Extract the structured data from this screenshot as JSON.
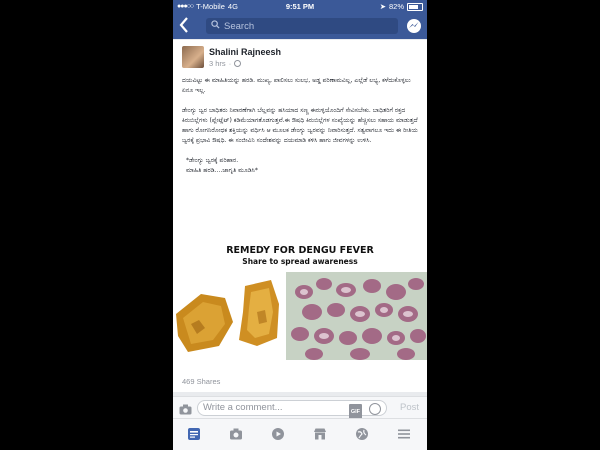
{
  "status": {
    "carrier": "T-Mobile",
    "network": "4G",
    "time": "9:51 PM",
    "battery": "82%"
  },
  "nav": {
    "search_placeholder": "Search"
  },
  "post": {
    "author": "Shalini Rajneesh",
    "time": "3 hrs",
    "paragraphs": [
      "ದಯವಿಟ್ಟು ಈ ಮಾಹಿತಿಯನ್ನು ಹರಡಿ. ಮುಖ್ಯ, ಪಾಲಿಸಲು ಸುಲಭ, ಅಡ್ಡ ಪರಿಣಾಮವಿಲ್ಲ, ಎಲ್ಲೆಡೆ ಲಭ್ಯ, ಕಳೆದುಕೊಳ್ಳಲು ಏನೂ ಇಲ್ಲ.",
      "ಡೇಂಗ್ಯು ಜ್ವರ ಬಾಧಿತರು ನಿವಾರಣೆಗಾಗಿ ಬೆಲ್ಲವನ್ನು ಹಸಿಯಾದ ಸಣ್ಣ ಈರುಳ್ಳಿಯೊಂದಿಗೆ ಸೇವಿಸಬೇಕು. ಬಾಧಿತರಿಗೆ ರಕ್ತದ ಕಿರುಬಿಲ್ಲೆಗಳು (ಪ್ಲೇಟ್ಲೆಟ್) ಕಡಿಮೆಯಾಗತೊಡಗುತ್ತವೆ.ಈ ಔಷಧಿ ಕಿರುಬಿಲ್ಲೆಗಳ ಸಂಖ್ಯೆಯನ್ನು ಹೆಚ್ಚಿಸಲು ಸಹಾಯ ಮಾಡುತ್ತದೆ ಹಾಗು ರೋಗನಿರೋಧಕ ಶಕ್ತಿಯನ್ನು ವರ್ಧಿಸಿ ಆ ಮೂಲಕ ಡೇಂಗ್ಯು ಜ್ವರವನ್ನು ನಿವಾರಿಸುತ್ತದೆ. ಸತ್ವವಾಗಲೂ ಇದು ಈ ರೀತಿಯ ಜ್ವರಕ್ಕೆ ಪ್ರಭಾವಿ ಔಷಧಿ. ಈ ಸಂಜೀವಿನಿ ಸಂದೇಶವನ್ನು ದಯಮಾಡಿ ಕಳಿಸಿ ಹಾಗು ಜೀವಗಳನ್ನು ಉಳಿಸಿ."
    ],
    "closing_line1": "*ಡೇಂಗ್ಯು ಜ್ವರಕ್ಕೆ ಪರಿಹಾರ.",
    "closing_line2": "ಮಾಹಿತಿ ಹರಡಿ....ಜಾಗೃತಿ ಮೂಡಿಸಿ*",
    "banner_title": "REMEDY FOR DENGU FEVER",
    "banner_subtitle": "Share to spread awareness",
    "shares": "469 Shares"
  },
  "comment": {
    "placeholder": "Write a comment...",
    "gif_label": "GIF",
    "post_label": "Post"
  },
  "icons": {
    "back": "chevron-left-icon",
    "messenger": "messenger-icon",
    "camera": "camera-icon",
    "tabs": [
      "news-feed-icon",
      "camera-icon",
      "video-icon",
      "marketplace-icon",
      "globe-icon",
      "menu-icon"
    ]
  },
  "colors": {
    "brand": "#3b5998",
    "active_tab": "#4267b2",
    "inactive_tab": "#90949c"
  }
}
